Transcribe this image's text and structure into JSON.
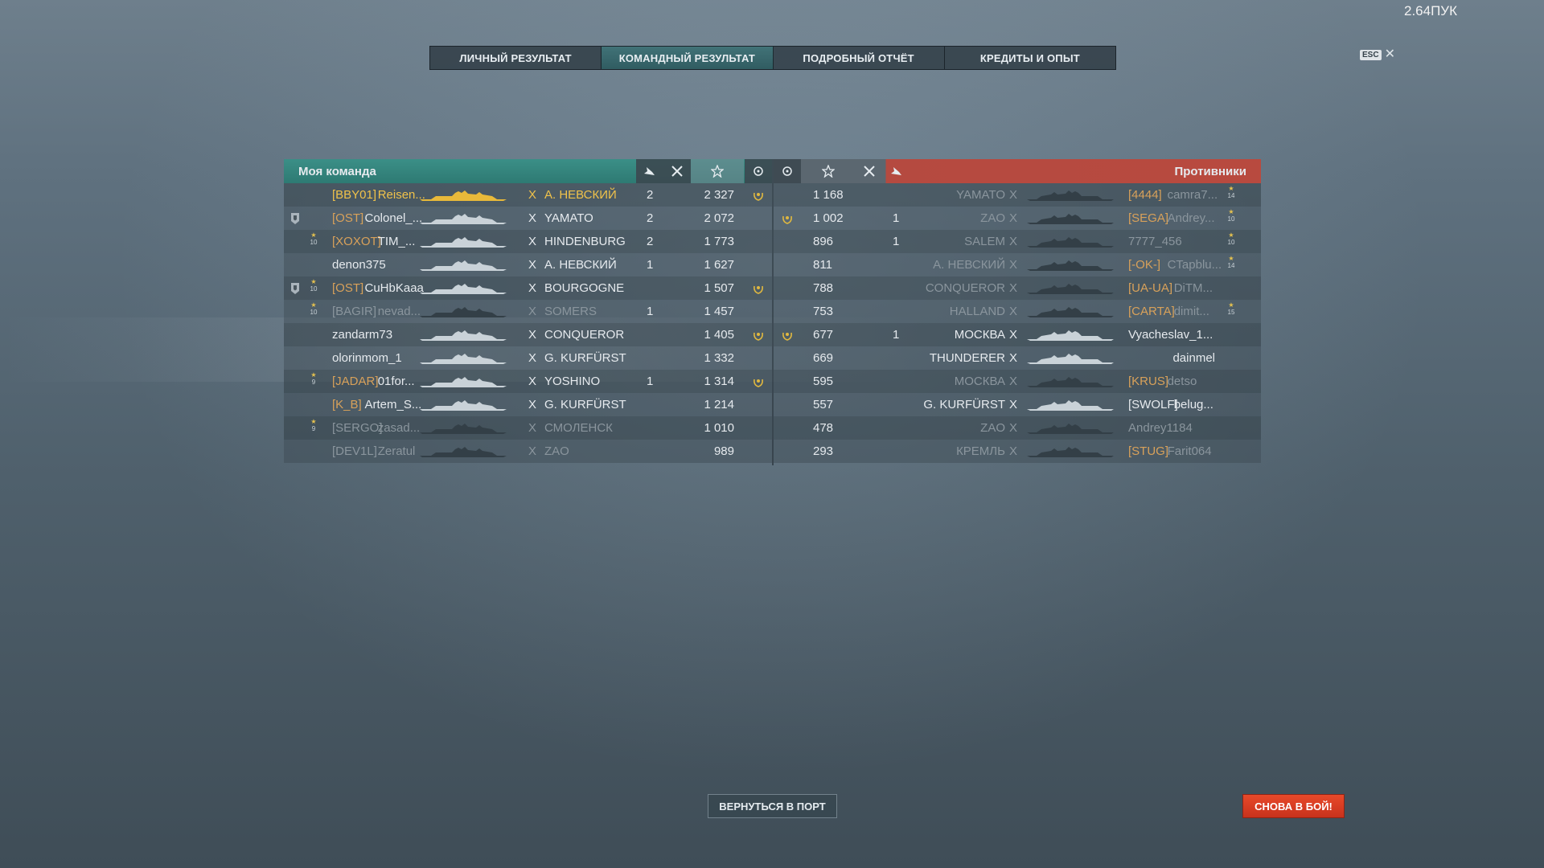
{
  "fps": "2.64ПУК",
  "tabs": [
    "ЛИЧНЫЙ РЕЗУЛЬТАТ",
    "КОМАНДНЫЙ РЕЗУЛЬТАТ",
    "ПОДРОБНЫЙ ОТЧЁТ",
    "КРЕДИТЫ И ОПЫТ"
  ],
  "active_tab": 1,
  "esc_label": "ESC",
  "my_team": {
    "title": "Моя команда",
    "rows": [
      {
        "clan": "[BBY01]",
        "name": "Reisen...",
        "x": "X",
        "ship": "А. НЕВСКИЙ",
        "kills": "2",
        "score": "2 327",
        "icon": "laurel",
        "rank": "",
        "highlight": true
      },
      {
        "clan": "[OST]",
        "name": "Colonel_...",
        "x": "X",
        "ship": "YAMATO",
        "kills": "2",
        "score": "2 072",
        "icon": "",
        "rank": "",
        "div": true
      },
      {
        "clan": "[XOXOT]",
        "name": "TIM_...",
        "x": "X",
        "ship": "HINDENBURG",
        "kills": "2",
        "score": "1 773",
        "icon": "",
        "rank": "10"
      },
      {
        "clan": "",
        "name": "denon375",
        "x": "X",
        "ship": "А. НЕВСКИЙ",
        "kills": "1",
        "score": "1 627",
        "icon": "",
        "rank": ""
      },
      {
        "clan": "[OST]",
        "name": "CuHbKaaa",
        "x": "X",
        "ship": "BOURGOGNE",
        "kills": "",
        "score": "1 507",
        "icon": "laurel",
        "rank": "10",
        "div": true
      },
      {
        "clan": "[BAGIR]",
        "name": "nevad...",
        "x": "X",
        "ship": "SOMERS",
        "kills": "1",
        "score": "1 457",
        "icon": "",
        "rank": "10",
        "dead": true
      },
      {
        "clan": "",
        "name": "zandarm73",
        "x": "X",
        "ship": "CONQUEROR",
        "kills": "",
        "score": "1 405",
        "icon": "laurel",
        "rank": ""
      },
      {
        "clan": "",
        "name": "olorinmom_1",
        "x": "X",
        "ship": "G. KURFÜRST",
        "kills": "",
        "score": "1 332",
        "icon": "",
        "rank": ""
      },
      {
        "clan": "[JADAR]",
        "name": "01for...",
        "x": "X",
        "ship": "YOSHINO",
        "kills": "1",
        "score": "1 314",
        "icon": "laurel",
        "rank": "9"
      },
      {
        "clan": "[K_B]",
        "name": "Artem_S...",
        "x": "X",
        "ship": "G. KURFÜRST",
        "kills": "",
        "score": "1 214",
        "icon": "",
        "rank": ""
      },
      {
        "clan": "[SERGO]",
        "name": "zasad...",
        "x": "X",
        "ship": "СМОЛЕНСК",
        "kills": "",
        "score": "1 010",
        "icon": "",
        "rank": "9",
        "dead": true
      },
      {
        "clan": "[DEV1L]",
        "name": "Zeratul",
        "x": "X",
        "ship": "ZAO",
        "kills": "",
        "score": "989",
        "icon": "",
        "rank": "",
        "dead": true
      }
    ]
  },
  "enemy_team": {
    "title": "Противники",
    "rows": [
      {
        "icon": "",
        "score": "1 168",
        "kills": "",
        "ship": "YAMATO",
        "x": "X",
        "clan": "[4444]",
        "name": "camra7...",
        "rank": "14",
        "dead": true
      },
      {
        "icon": "laurel",
        "score": "1 002",
        "kills": "1",
        "ship": "ZAO",
        "x": "X",
        "clan": "[SEGA]",
        "name": "Andrey...",
        "rank": "10",
        "dead": true
      },
      {
        "icon": "",
        "score": "896",
        "kills": "1",
        "ship": "SALEM",
        "x": "X",
        "clan": "",
        "name": "7777_456",
        "rank": "10",
        "dead": true
      },
      {
        "icon": "",
        "score": "811",
        "kills": "",
        "ship": "А. НЕВСКИЙ",
        "x": "X",
        "clan": "[-OK-]",
        "name": "CTapblu...",
        "rank": "14",
        "dead": true
      },
      {
        "icon": "",
        "score": "788",
        "kills": "",
        "ship": "CONQUEROR",
        "x": "X",
        "clan": "[UA-UA]",
        "name": "DiTM...",
        "rank": "",
        "dead": true
      },
      {
        "icon": "",
        "score": "753",
        "kills": "",
        "ship": "HALLAND",
        "x": "X",
        "clan": "[CARTA]",
        "name": "dimit...",
        "rank": "15",
        "dead": true
      },
      {
        "icon": "laurel",
        "score": "677",
        "kills": "1",
        "ship": "МОСКВА",
        "x": "X",
        "clan": "",
        "name": "Vyacheslav_1...",
        "rank": ""
      },
      {
        "icon": "",
        "score": "669",
        "kills": "",
        "ship": "THUNDERER",
        "x": "X",
        "clan": "",
        "name": "dainmel",
        "rank": ""
      },
      {
        "icon": "",
        "score": "595",
        "kills": "",
        "ship": "МОСКВА",
        "x": "X",
        "clan": "[KRUS]",
        "name": "detso",
        "rank": "",
        "dead": true
      },
      {
        "icon": "",
        "score": "557",
        "kills": "",
        "ship": "G. KURFÜRST",
        "x": "X",
        "clan": "[SWOLF]",
        "name": "belug...",
        "rank": ""
      },
      {
        "icon": "",
        "score": "478",
        "kills": "",
        "ship": "ZAO",
        "x": "X",
        "clan": "",
        "name": "Andrey1184",
        "rank": "",
        "dead": true
      },
      {
        "icon": "",
        "score": "293",
        "kills": "",
        "ship": "КРЕМЛЬ",
        "x": "X",
        "clan": "[STUG]",
        "name": "Farit064",
        "rank": "",
        "dead": true
      }
    ]
  },
  "buttons": {
    "port": "ВЕРНУТЬСЯ В ПОРТ",
    "battle": "СНОВА В БОЙ!"
  },
  "colors": {
    "my_team": "#2e7a73",
    "enemy": "#b84a3f",
    "gold": "#f0c24a",
    "battle_button": "#d93a22"
  }
}
